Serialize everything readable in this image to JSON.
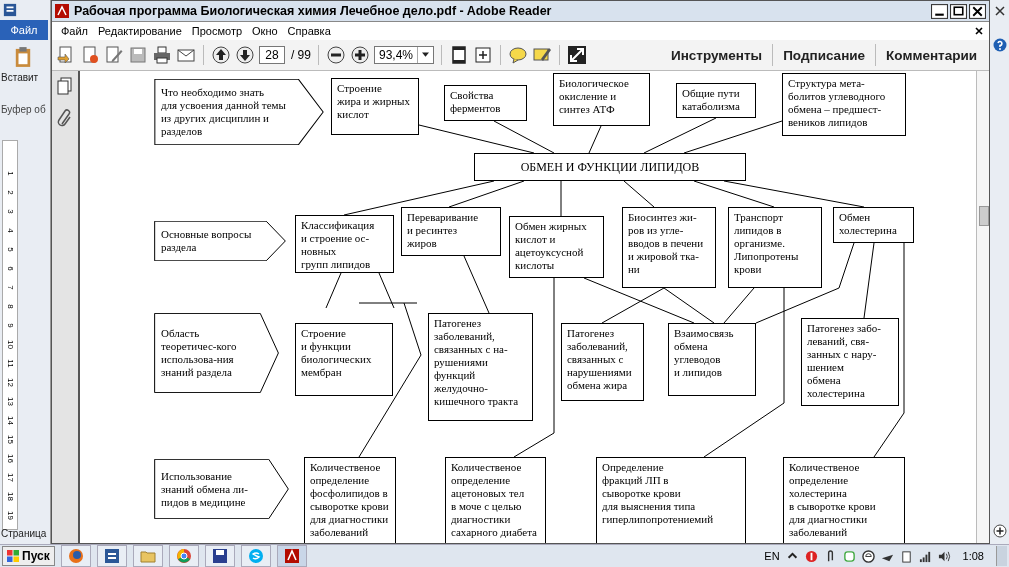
{
  "word_background": {
    "file_tab": "Файл",
    "paste_label": "Вставит",
    "clipboard_group": "Буфер об",
    "status": "Страница",
    "ruler_numbers": [
      "1",
      "2",
      "3",
      "4",
      "5",
      "6",
      "7",
      "8",
      "9",
      "10",
      "11",
      "12",
      "13",
      "14",
      "15",
      "16",
      "17",
      "18",
      "19"
    ]
  },
  "window": {
    "title": "Рабочая программа Биологическая химия Лечебное дело.pdf - Adobe Reader"
  },
  "menu": [
    "Файл",
    "Редактирование",
    "Просмотр",
    "Окно",
    "Справка"
  ],
  "toolbar": {
    "page": "28",
    "page_count": "/ 99",
    "zoom": "93,4%",
    "panels": [
      "Инструменты",
      "Подписание",
      "Комментарии"
    ]
  },
  "diagram": {
    "center": "ОБМЕН И ФУНКЦИИ ЛИПИДОВ",
    "rows": [
      {
        "heading": [
          "Что необходимо знать",
          "для усвоения данной темы",
          "из других дисциплин и",
          "разделов"
        ],
        "boxes": [
          [
            "Строение",
            "жира и жирных",
            "кислот"
          ],
          [
            "Свойства",
            "ферментов"
          ],
          [
            "Биологическое",
            "окисление и",
            "синтез АТФ"
          ],
          [
            "Общие пути",
            "катаболизма"
          ],
          [
            "Структура мета-",
            "болитов углеводного",
            "обмена – предшест-",
            "веников липидов"
          ]
        ]
      },
      {
        "heading": [
          "Основные вопросы",
          "раздела"
        ],
        "boxes": [
          [
            "Классификация",
            "и строение ос-",
            "новных",
            "групп липидов"
          ],
          [
            "Переваривание",
            "и ресинтез",
            "жиров"
          ],
          [
            "Обмен жирных",
            "кислот и",
            "ацетоуксусной",
            "кислоты"
          ],
          [
            "Биосинтез жи-",
            "ров из угле-",
            "вводов в печени",
            "и жировой тка-",
            "ни"
          ],
          [
            "Транспорт",
            "липидов в",
            "организме.",
            "Липопротены",
            "крови"
          ],
          [
            "Обмен",
            "холестерина"
          ]
        ]
      },
      {
        "heading": [
          "Область",
          "теоретичес-кого",
          "использова-ния",
          "знаний раздела"
        ],
        "boxes": [
          [
            "Строение",
            "и функции",
            "биологических",
            "мембран"
          ],
          [
            "Патогенез",
            "заболеваний,",
            "связанных с на-",
            "рушениями",
            "функций",
            "желудочно-",
            "кишечного тракта"
          ],
          [
            "Патогенез",
            "заболеваний,",
            "связанных с",
            "нарушениями",
            "обмена жира"
          ],
          [
            "Взаимосвязь",
            "обмена",
            "углеводов",
            "и липидов"
          ],
          [
            "Патогенез забо-",
            "леваний, свя-",
            "занных с нару-",
            "шением",
            "обмена",
            "холестерина"
          ]
        ]
      },
      {
        "heading": [
          "Использование",
          "знаний обмена ли-",
          "пидов в медицине"
        ],
        "boxes": [
          [
            "Количественое",
            "определение",
            "фосфолипидов в",
            "сыворотке крови",
            "для диагностики",
            "заболеваний"
          ],
          [
            "Количественое",
            "определение",
            "ацетоновых тел",
            "в моче с целью",
            "диагностики",
            "сахарного диабета"
          ],
          [
            "Определение",
            "фракций ЛП в",
            "сыворотке крови",
            "для выяснения типа",
            "гиперлипопротениемий"
          ],
          [
            "Количественое",
            "определение",
            "холестерина",
            "в сыворотке крови",
            "для диагностики",
            "заболеваний"
          ]
        ]
      }
    ]
  },
  "taskbar": {
    "start": "Пуск",
    "language": "EN",
    "clock": "1:08"
  }
}
